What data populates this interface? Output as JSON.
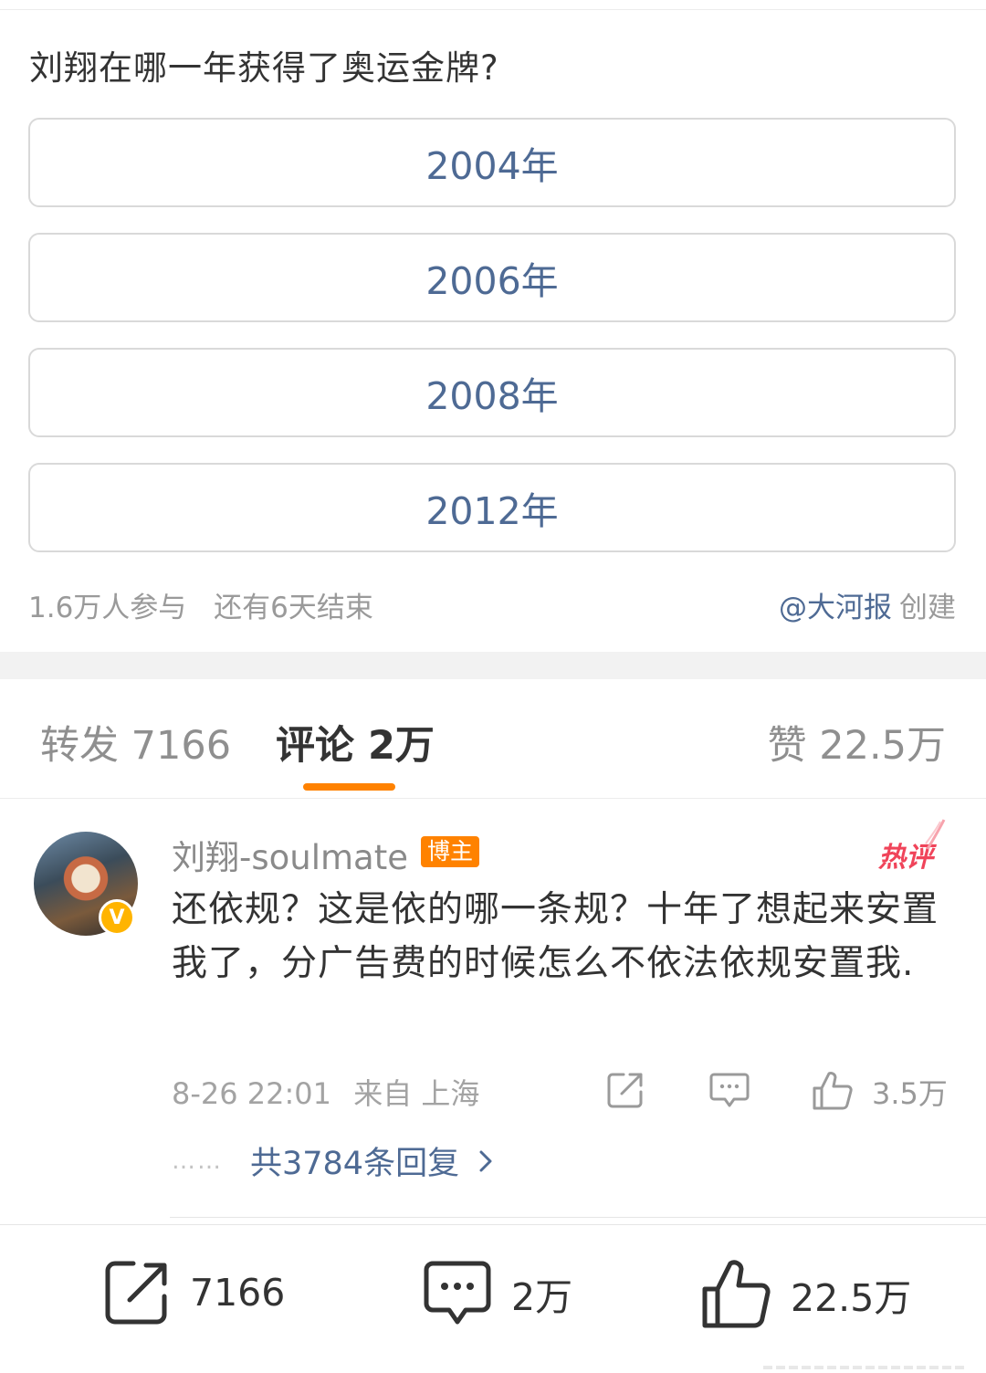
{
  "poll": {
    "question": "刘翔在哪一年获得了奥运金牌?",
    "options": [
      {
        "label": "2004年"
      },
      {
        "label": "2006年"
      },
      {
        "label": "2008年"
      },
      {
        "label": "2012年"
      }
    ],
    "participants": "1.6万人参与",
    "remaining": "还有6天结束",
    "creator": "@大河报",
    "creator_suffix": "创建"
  },
  "tabs": {
    "repost": "转发 7166",
    "comments": "评论 2万",
    "likes": "赞 22.5万",
    "active": "comments"
  },
  "comment": {
    "username": "刘翔-soulmate",
    "badge": "博主",
    "hot_tag": "热评",
    "verified_mark": "V",
    "text": "还依规？这是依的哪一条规？十年了想起来安置我了，分广告费的时候怎么不依法依规安置我.",
    "date": "8-26 22:01",
    "source": "来自 上海",
    "like_count": "3.5万",
    "replies_dots": "……",
    "replies_label": "共3784条回复",
    "icons": [
      "share-icon",
      "comment-icon",
      "like-icon",
      "chevron-right-icon"
    ]
  },
  "bottom_bar": {
    "repost_count": "7166",
    "comment_count": "2万",
    "like_count": "22.5万",
    "icons": [
      "repost-icon",
      "comment-icon",
      "like-icon"
    ]
  },
  "colors": {
    "link": "#4e6a94",
    "accent": "#ff8200",
    "hot": "#f0445a",
    "verified": "#ffb400"
  }
}
